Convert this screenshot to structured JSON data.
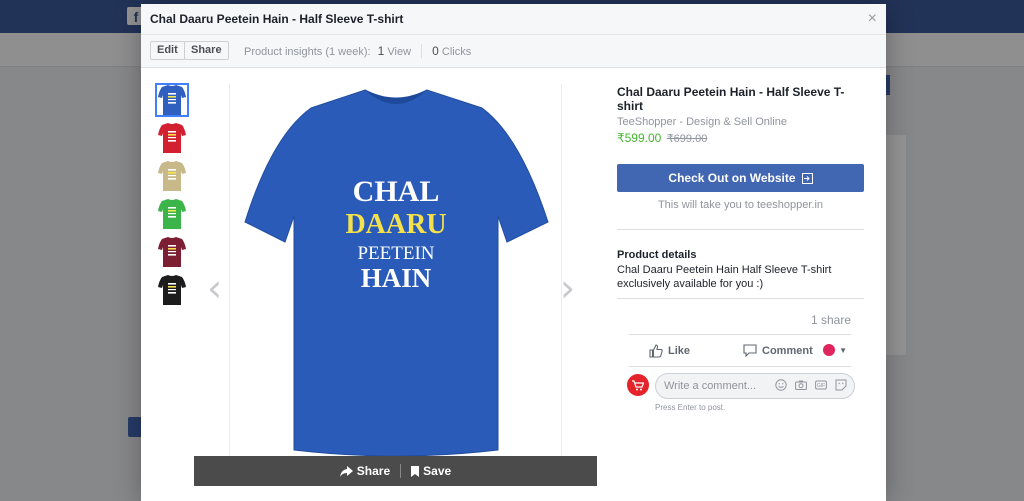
{
  "modal": {
    "title": "Chal Daaru Peetein Hain - Half Sleeve T-shirt",
    "close_glyph": "×"
  },
  "toolbar": {
    "edit_label": "Edit",
    "share_label": "Share",
    "insights_label": "Product insights (1 week):",
    "views_count": "1",
    "views_label": "View",
    "clicks_count": "0",
    "clicks_label": "Clicks"
  },
  "thumbnails": [
    {
      "color": "#2f5fbf",
      "print": "#ffffff"
    },
    {
      "color": "#d32030",
      "print": "#ffffff"
    },
    {
      "color": "#c8b98b",
      "print": "#ffffff"
    },
    {
      "color": "#3bb54a",
      "print": "#ffffff"
    },
    {
      "color": "#7d1f33",
      "print": "#ffffff"
    },
    {
      "color": "#1c1c1c",
      "print": "#ffffff"
    }
  ],
  "main_image": {
    "shirt_color": "#2b5bb8",
    "line1": "CHAL",
    "line2": "DAARU",
    "line3": "PEETEIN",
    "line4": "HAIN",
    "line2_color": "#f5e24a"
  },
  "image_actions": {
    "share_label": "Share",
    "save_label": "Save"
  },
  "product": {
    "title": "Chal Daaru Peetein Hain - Half Sleeve T-shirt",
    "seller": "TeeShopper - Design & Sell Online",
    "price": "₹599.00",
    "old_price": "₹699.00",
    "checkout_label": "Check Out on Website",
    "checkout_note": "This will take you to teeshopper.in",
    "details_heading": "Product details",
    "details_text": "Chal Daaru Peetein Hain Half Sleeve T-shirt exclusively available for you :)"
  },
  "engagement": {
    "share_count": "1 share",
    "like_label": "Like",
    "comment_label": "Comment",
    "comment_placeholder": "Write a comment...",
    "press_enter": "Press Enter to post."
  },
  "colors": {
    "accent": "#4267b2",
    "price_green": "#42b72a",
    "facebook_blue": "#3b5998"
  }
}
